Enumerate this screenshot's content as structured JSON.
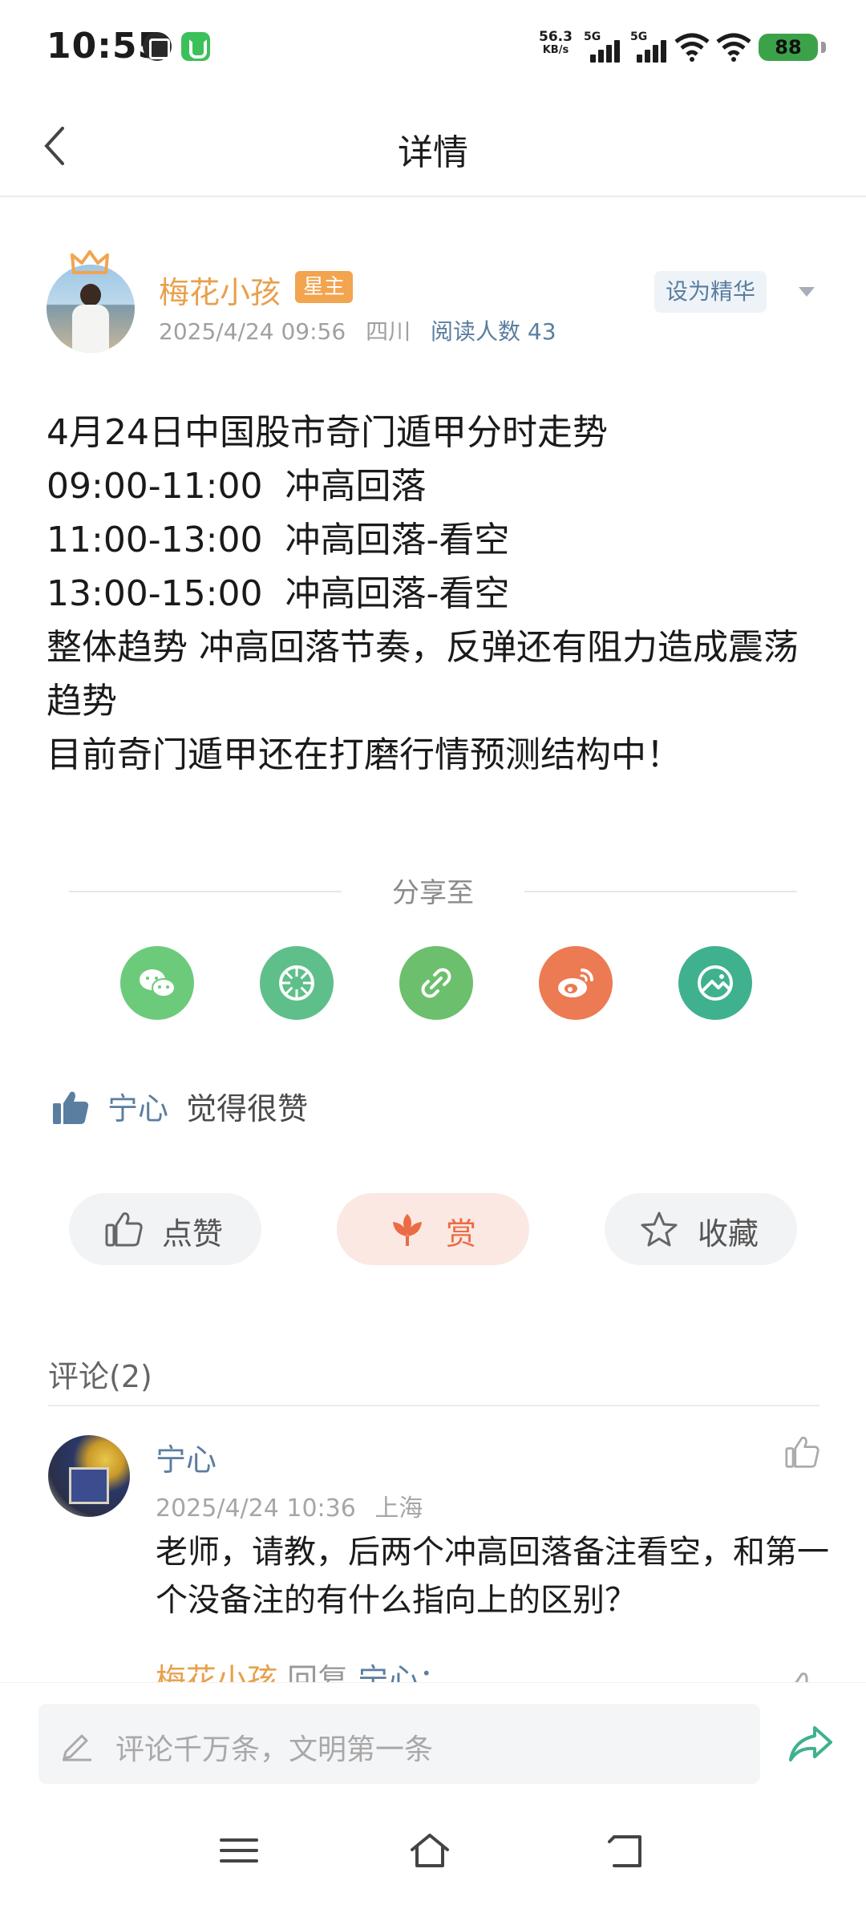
{
  "status_bar": {
    "time": "10:55",
    "net_speed_value": "56.3",
    "net_speed_unit": "KB/s",
    "sim1_label": "5G",
    "sim2_label": "5G",
    "battery": "88"
  },
  "header": {
    "title": "详情",
    "back_icon": "chevron-left-icon"
  },
  "author": {
    "name": "梅花小孩",
    "badge": "星主",
    "date": "2025/4/24 09:56",
    "location": "四川",
    "reads": "阅读人数 43",
    "essence_button": "设为精华",
    "more_icon": "caret-down-icon"
  },
  "post": {
    "text": "4月24日中国股市奇门遁甲分时走势\n09:00-11:00  冲高回落\n11:00-13:00  冲高回落-看空\n13:00-15:00  冲高回落-看空\n整体趋势 冲高回落节奏，反弹还有阻力造成震荡趋势\n目前奇门遁甲还在打磨行情预测结构中！"
  },
  "share": {
    "title": "分享至",
    "targets": [
      {
        "icon": "wechat-icon",
        "color": "#6ccb7b"
      },
      {
        "icon": "moments-icon",
        "color": "#5fbf8a"
      },
      {
        "icon": "link-icon",
        "color": "#6cbf6c"
      },
      {
        "icon": "weibo-icon",
        "color": "#ec7a52"
      },
      {
        "icon": "gallery-icon",
        "color": "#3fb18f"
      }
    ]
  },
  "likes": {
    "name": "宁心",
    "text": "觉得很赞"
  },
  "actions": {
    "like": "点赞",
    "reward": "赏",
    "favorite": "收藏"
  },
  "comments": {
    "header": "评论(2)",
    "items": [
      {
        "name": "宁心",
        "date": "2025/4/24 10:36",
        "location": "上海",
        "text": "老师，请教，后两个冲高回落备注看空，和第一个没备注的有什么指向上的区别？"
      }
    ],
    "reply_peek": {
      "name": "梅花小孩",
      "verb": "回复",
      "target": "宁心："
    }
  },
  "input": {
    "placeholder": "评论千万条，文明第一条"
  },
  "nav": [
    "menu-icon",
    "home-icon",
    "back-icon"
  ],
  "colors": {
    "accent_orange": "#e8a04c",
    "link_blue": "#5a7ea0",
    "reward_red": "#ea6b45",
    "share_teal": "#3fb18f"
  }
}
